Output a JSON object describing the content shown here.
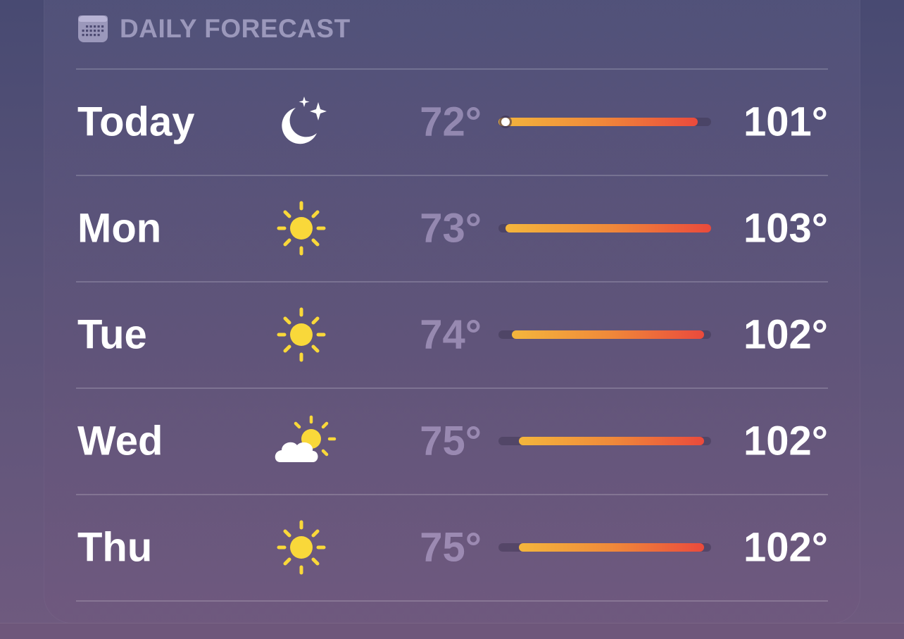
{
  "header": {
    "title": "DAILY FORECAST",
    "icon": "calendar-icon"
  },
  "range": {
    "min": 72,
    "max": 103
  },
  "colors": {
    "bar_start": "#f4b63c",
    "bar_mid": "#f08a3a",
    "bar_end": "#ea4a3c",
    "sun": "#f9d83a"
  },
  "days": [
    {
      "label": "Today",
      "icon": "moon-stars-icon",
      "low": "72°",
      "high": "101°",
      "low_value": 72,
      "high_value": 101,
      "current_value": 72
    },
    {
      "label": "Mon",
      "icon": "sun-icon",
      "low": "73°",
      "high": "103°",
      "low_value": 73,
      "high_value": 103
    },
    {
      "label": "Tue",
      "icon": "sun-icon",
      "low": "74°",
      "high": "102°",
      "low_value": 74,
      "high_value": 102
    },
    {
      "label": "Wed",
      "icon": "partly-cloudy-icon",
      "low": "75°",
      "high": "102°",
      "low_value": 75,
      "high_value": 102
    },
    {
      "label": "Thu",
      "icon": "sun-icon",
      "low": "75°",
      "high": "102°",
      "low_value": 75,
      "high_value": 102
    }
  ]
}
